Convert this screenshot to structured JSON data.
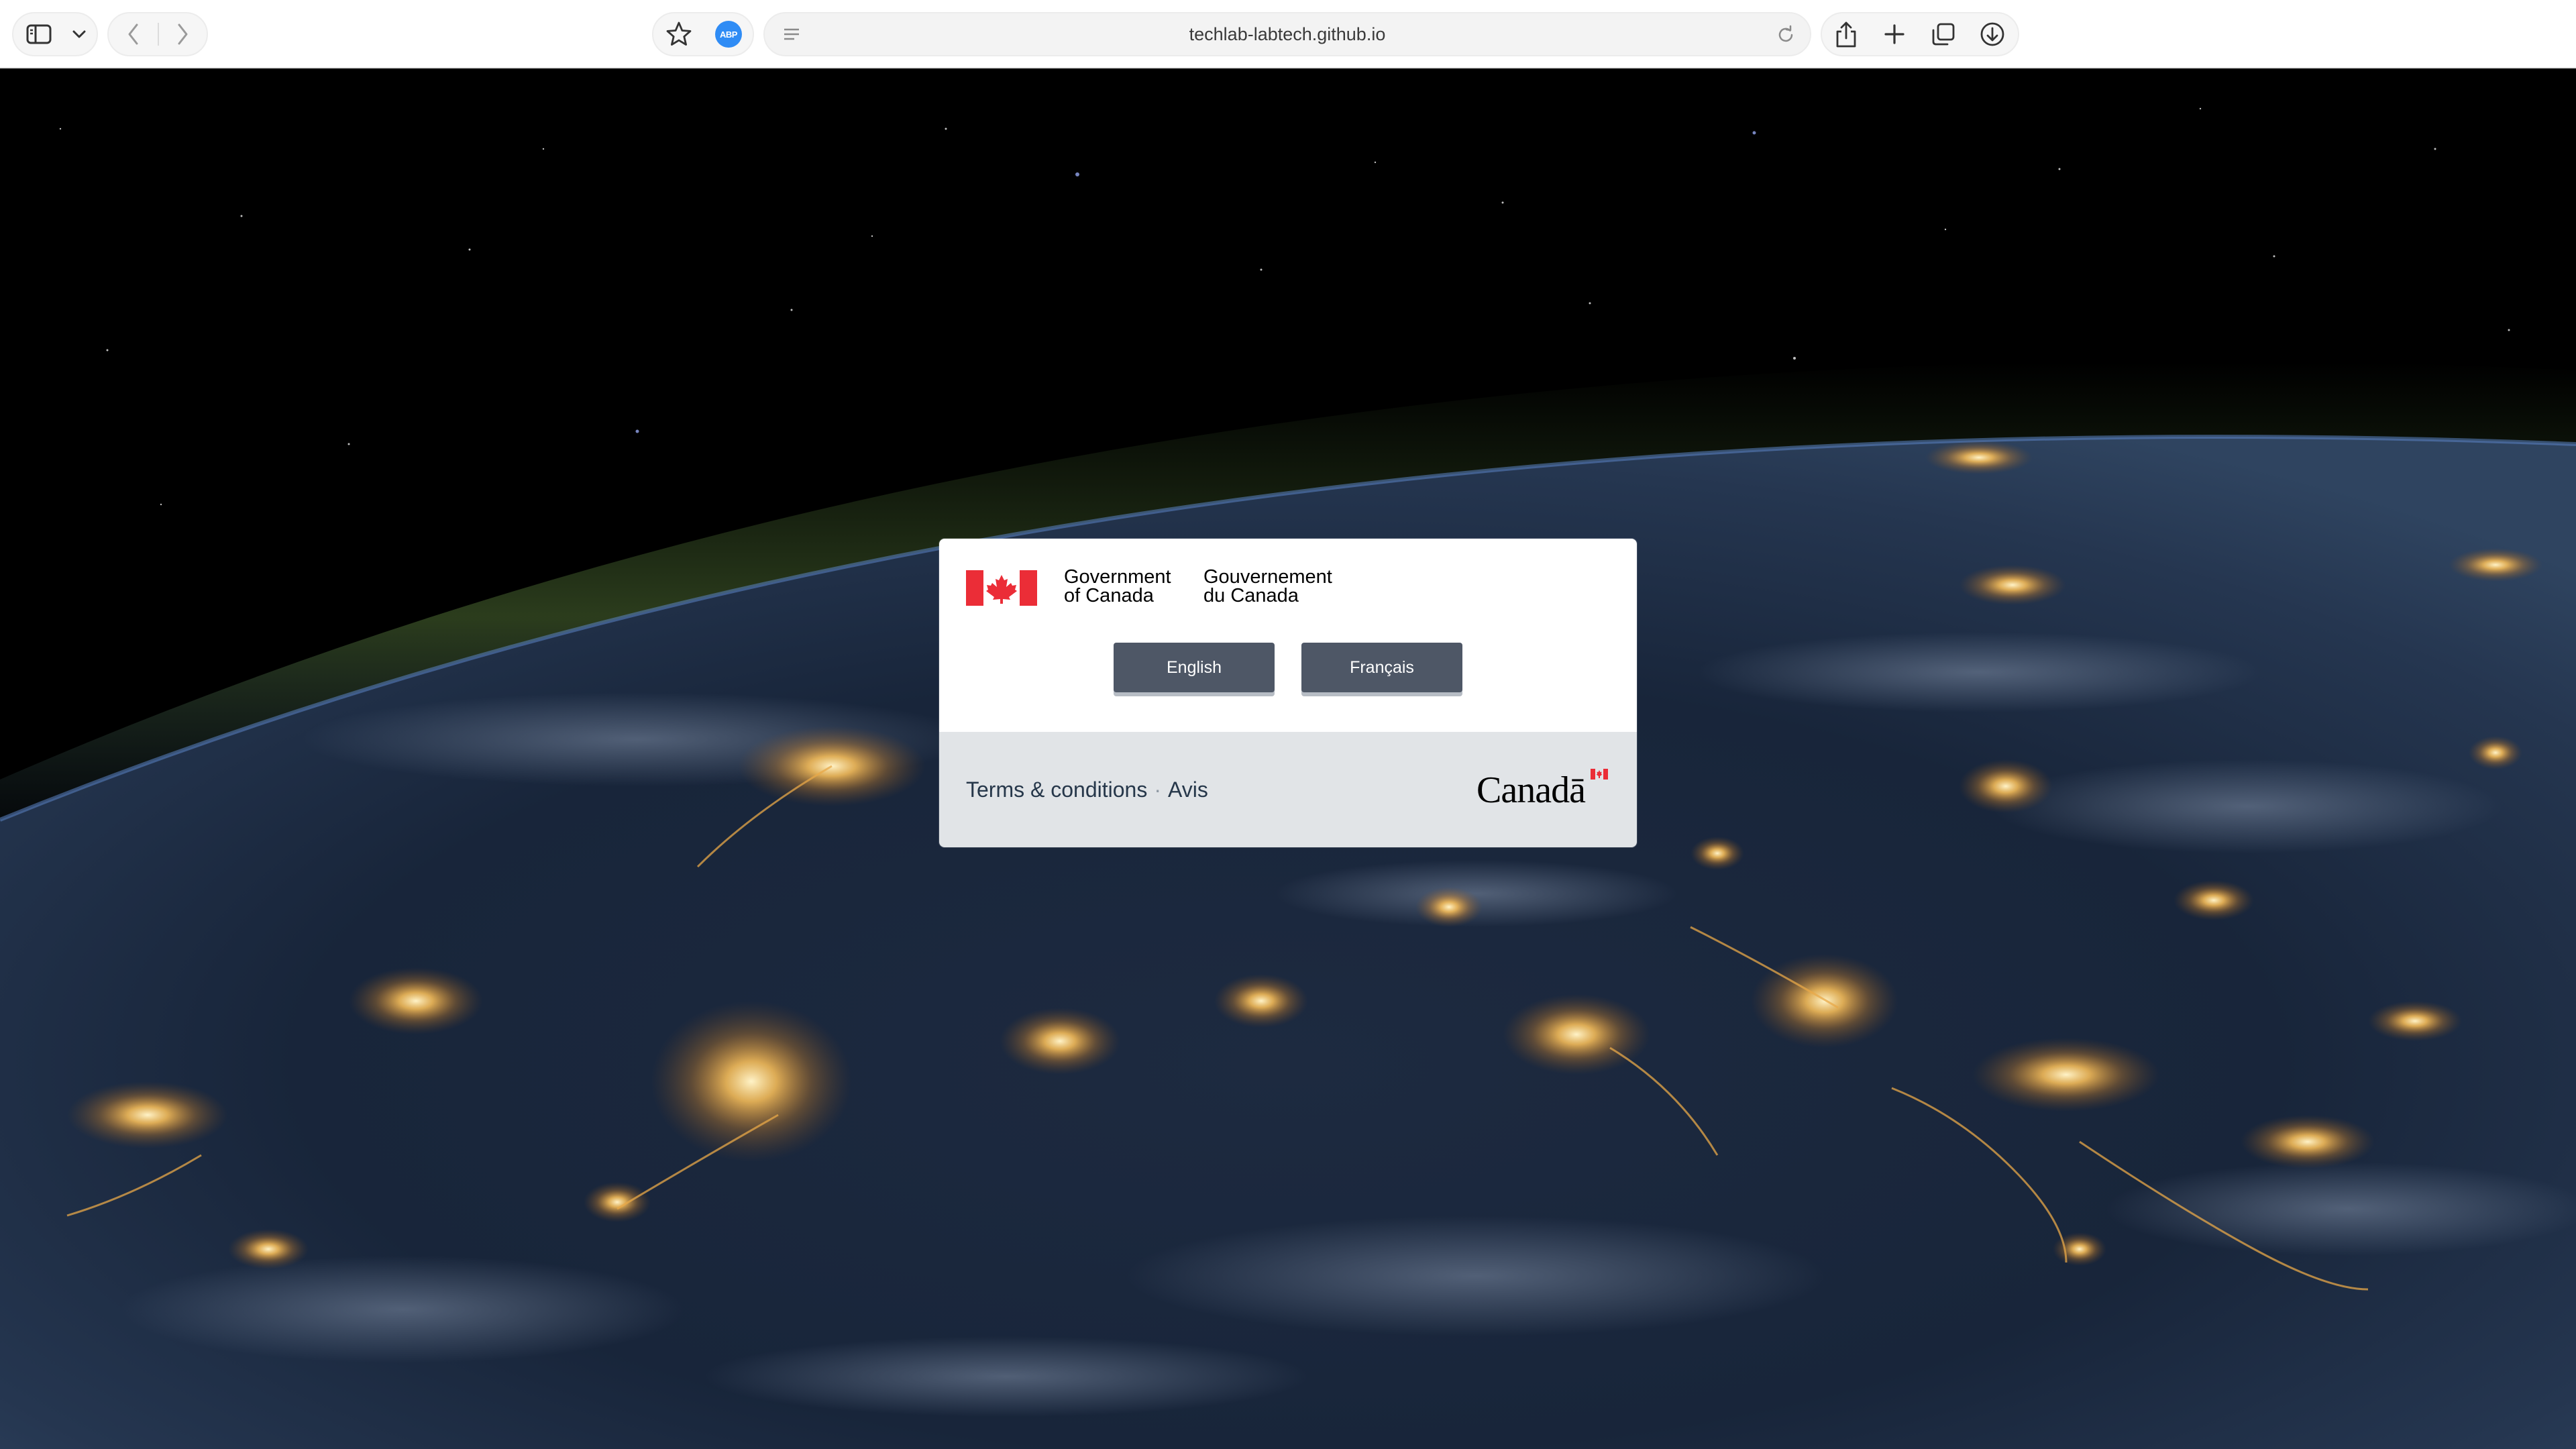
{
  "browser": {
    "url": "techlab-labtech.github.io",
    "extension_label": "ABP",
    "icons": {
      "sidebar": "sidebar-icon",
      "chevron": "chevron-down-icon",
      "back": "back-arrow-icon",
      "forward": "forward-arrow-icon",
      "bookmark": "star-icon",
      "extension": "adblock-plus-icon",
      "reader": "reader-icon",
      "reload": "reload-icon",
      "share": "share-icon",
      "new_tab": "plus-icon",
      "tabs": "tab-overview-icon",
      "downloads": "download-icon"
    }
  },
  "splash": {
    "signature": {
      "en_line1": "Government",
      "en_line2": "of Canada",
      "fr_line1": "Gouvernement",
      "fr_line2": "du Canada"
    },
    "buttons": {
      "english": "English",
      "french": "Français"
    },
    "footer": {
      "terms_en": "Terms & conditions",
      "separator": "·",
      "terms_fr": "Avis",
      "wordmark": "Canadā"
    }
  },
  "colors": {
    "flag_red": "#eb2d37",
    "button_bg": "#4e5766",
    "link": "#26374a",
    "footer_bg": "#e1e4e7"
  }
}
